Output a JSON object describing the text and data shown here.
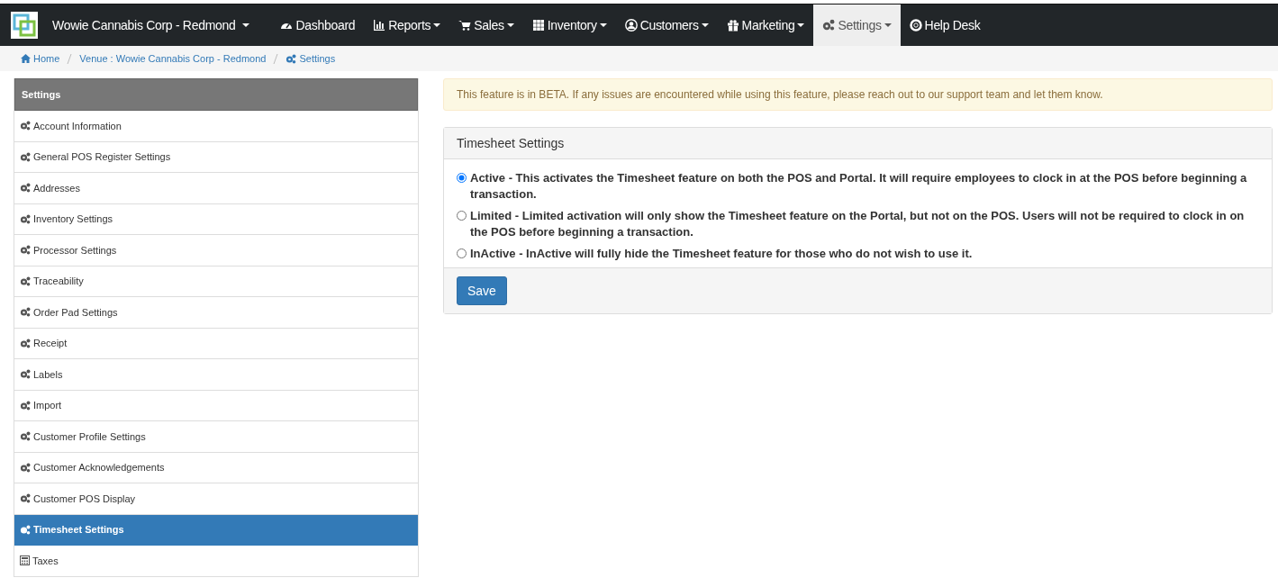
{
  "navbar": {
    "brand": "Wowie Cannabis Corp - Redmond",
    "brand_dropdown": true,
    "items": [
      {
        "label": "Dashboard",
        "dropdown": false,
        "selected": false
      },
      {
        "label": "Reports",
        "dropdown": true,
        "selected": false
      },
      {
        "label": "Sales",
        "dropdown": true,
        "selected": false
      },
      {
        "label": "Inventory",
        "dropdown": true,
        "selected": false
      },
      {
        "label": "Customers",
        "dropdown": true,
        "selected": false
      },
      {
        "label": "Marketing",
        "dropdown": true,
        "selected": false
      },
      {
        "label": "Settings",
        "dropdown": true,
        "selected": true
      },
      {
        "label": "Help Desk",
        "dropdown": false,
        "selected": false
      }
    ]
  },
  "breadcrumb": [
    "Home",
    "Venue : Wowie Cannabis Corp - Redmond",
    "Settings"
  ],
  "sidebar": {
    "title": "Settings",
    "items": [
      {
        "label": "Account Information",
        "selected": false
      },
      {
        "label": "General POS Register Settings",
        "selected": false
      },
      {
        "label": "Addresses",
        "selected": false
      },
      {
        "label": "Inventory Settings",
        "selected": false
      },
      {
        "label": "Processor Settings",
        "selected": false
      },
      {
        "label": "Traceability",
        "selected": false
      },
      {
        "label": "Order Pad Settings",
        "selected": false
      },
      {
        "label": "Receipt",
        "selected": false
      },
      {
        "label": "Labels",
        "selected": false
      },
      {
        "label": "Import",
        "selected": false
      },
      {
        "label": "Customer Profile Settings",
        "selected": false
      },
      {
        "label": "Customer Acknowledgements",
        "selected": false
      },
      {
        "label": "Customer POS Display",
        "selected": false
      },
      {
        "label": "Timesheet Settings",
        "selected": true
      },
      {
        "label": "Taxes",
        "selected": false
      }
    ]
  },
  "alert": "This feature is in BETA. If any issues are encountered while using this feature, please reach out to our support team and let them know.",
  "panel": {
    "title": "Timesheet Settings",
    "options": [
      {
        "label": "Active - This activates the Timesheet feature on both the POS and Portal. It will require employees to clock in at the POS before beginning a transaction.",
        "selected": true
      },
      {
        "label": "Limited - Limited activation will only show the Timesheet feature on the Portal, but not on the POS. Users will not be required to clock in on the POS before beginning a transaction.",
        "selected": false
      },
      {
        "label": "InActive - InActive will fully hide the Timesheet feature for those who do not wish to use it.",
        "selected": false
      }
    ],
    "button": "Save"
  }
}
